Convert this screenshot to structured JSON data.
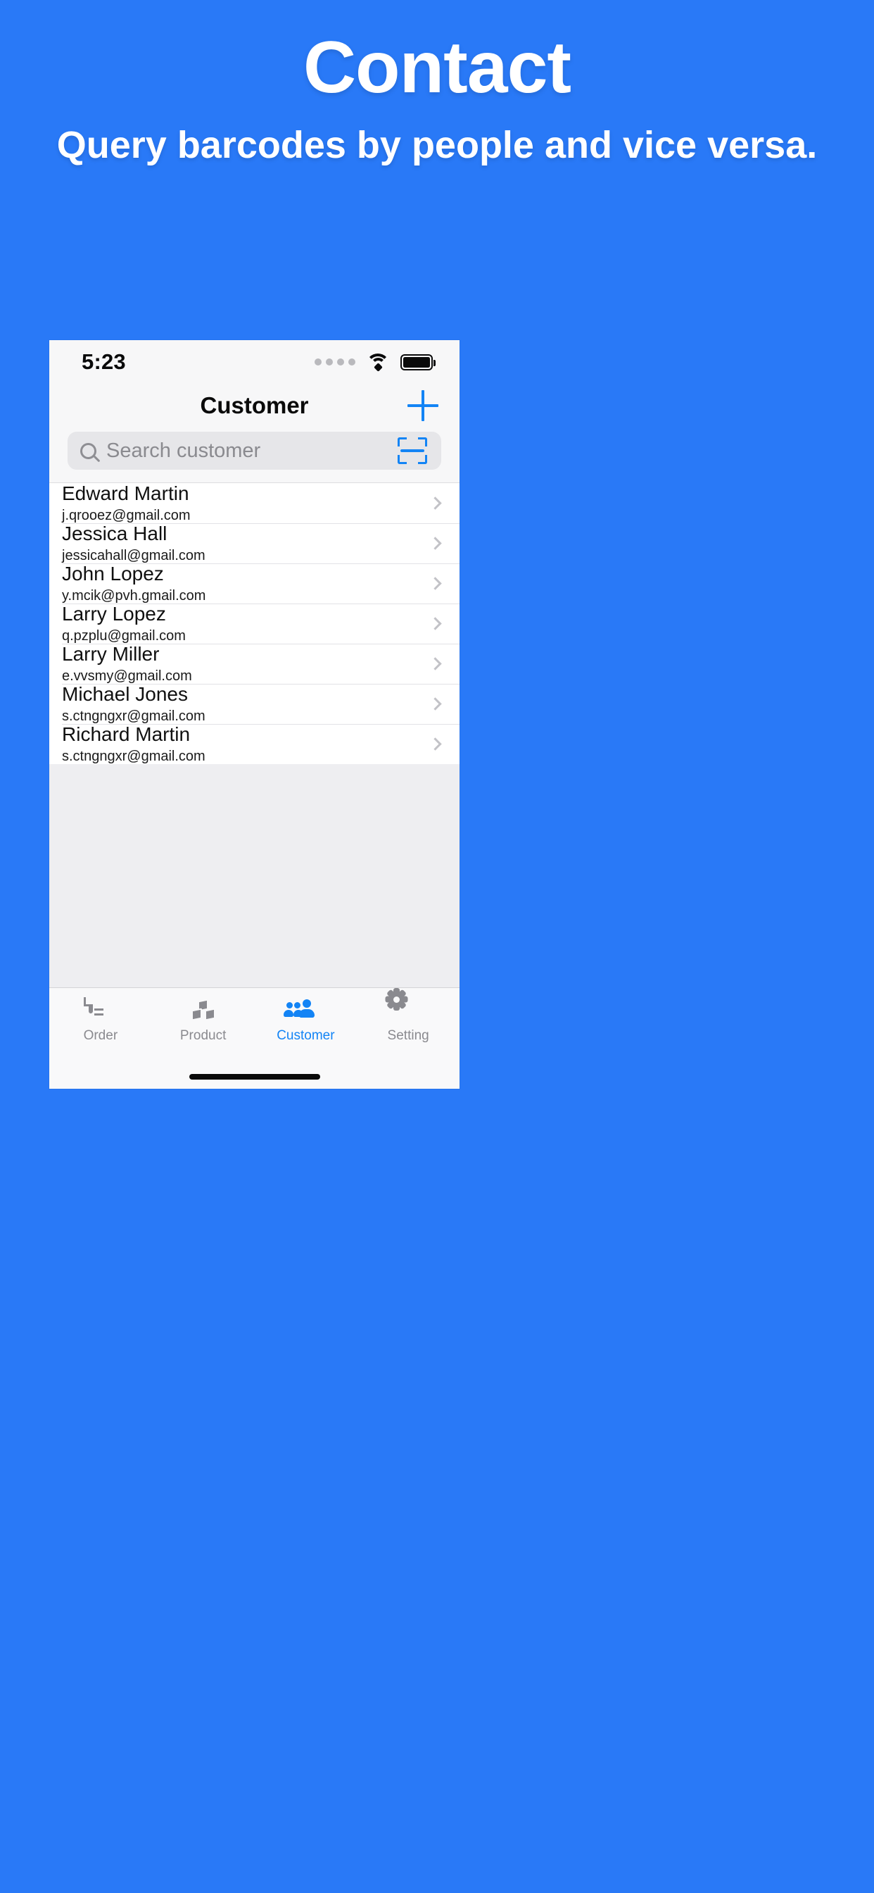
{
  "theme": {
    "brand_blue": "#2979f7",
    "accent_blue": "#1384f5",
    "muted_gray": "#8a8a8f"
  },
  "marketing": {
    "headline": "Contact",
    "subhead": "Query barcodes by people and vice versa."
  },
  "phone": {
    "statusbar": {
      "time": "5:23",
      "signal_icon": "signal-dots-icon",
      "wifi_icon": "wifi-icon",
      "battery_icon": "battery-full-icon"
    },
    "navbar": {
      "title": "Customer",
      "add_icon": "plus-icon"
    },
    "search": {
      "placeholder": "Search customer",
      "value": "",
      "search_icon": "search-icon",
      "scan_icon": "barcode-scan-icon"
    },
    "contacts": [
      {
        "name": "Edward Martin",
        "email": "j.qrooez@gmail.com"
      },
      {
        "name": "Jessica Hall",
        "email": "jessicahall@gmail.com"
      },
      {
        "name": "John Lopez",
        "email": "y.mcik@pvh.gmail.com"
      },
      {
        "name": "Larry Lopez",
        "email": "q.pzplu@gmail.com"
      },
      {
        "name": "Larry Miller",
        "email": "e.vvsmy@gmail.com"
      },
      {
        "name": "Michael Jones",
        "email": "s.ctngngxr@gmail.com"
      },
      {
        "name": "Richard Martin",
        "email": "s.ctngngxr@gmail.com"
      }
    ],
    "tabs": [
      {
        "label": "Order",
        "icon": "document-icon",
        "active": false
      },
      {
        "label": "Product",
        "icon": "cubes-icon",
        "active": false
      },
      {
        "label": "Customer",
        "icon": "people-icon",
        "active": true
      },
      {
        "label": "Setting",
        "icon": "gear-icon",
        "active": false
      }
    ]
  }
}
